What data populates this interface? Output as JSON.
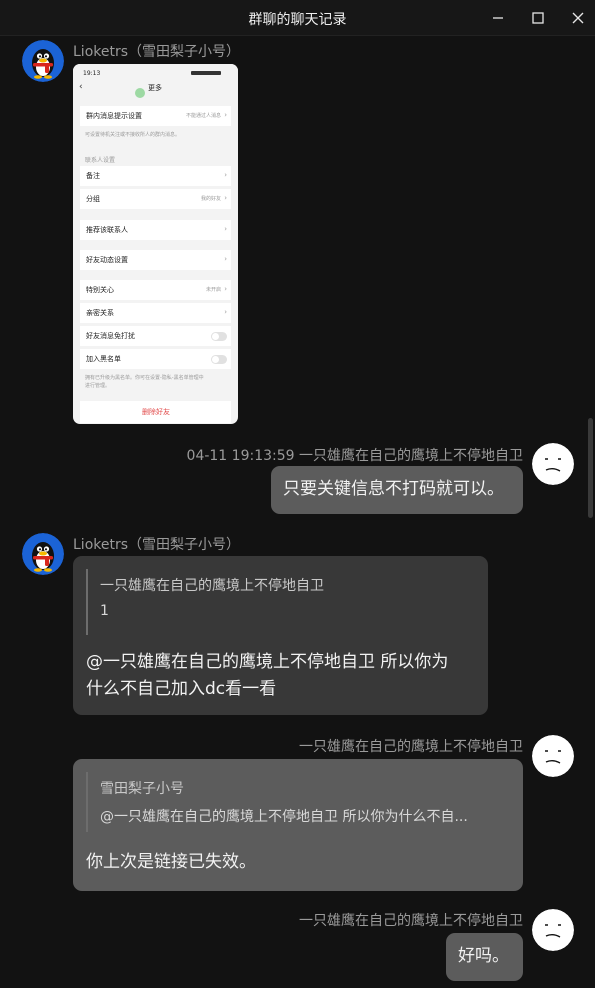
{
  "window": {
    "title": "群聊的聊天记录"
  },
  "messages": [
    {
      "sender": "Lioketrs（雪田梨子小号）",
      "screenshot": {
        "status_time": "19:13",
        "header_title": "更多",
        "rows": [
          {
            "label": "群内消息提示设置",
            "value": "不能通过人消息"
          },
          {
            "label": "备注"
          },
          {
            "label": "分组",
            "value": "我的好友"
          },
          {
            "label": "推荐该联系人"
          },
          {
            "label": "好友动态设置"
          },
          {
            "label": "特别关心",
            "value": "未开启"
          },
          {
            "label": "亲密关系"
          },
          {
            "label": "好友消息免打扰"
          },
          {
            "label": "加入黑名单"
          }
        ],
        "note1": "可设置待机关注或不接收所人的群内消息。",
        "category": "联系人设置",
        "note2a": "拥有已升级为黑名单。你可在设置-隐私-黑名单管理中",
        "note2b": "进行管理。",
        "delete_label": "删除好友"
      }
    },
    {
      "time_sender": "04-11 19:13:59 一只雄鹰在自己的鹰境上不停地自卫",
      "text": "只要关键信息不打码就可以。"
    },
    {
      "sender": "Lioketrs（雪田梨子小号）",
      "quote_name": "一只雄鹰在自己的鹰境上不停地自卫",
      "quote_text": "1",
      "text_line1": "@一只雄鹰在自己的鹰境上不停地自卫 所以你为",
      "text_line2": "什么不自己加入dc看一看"
    },
    {
      "sender": "一只雄鹰在自己的鹰境上不停地自卫",
      "quote_name": "雪田梨子小号",
      "quote_text": "@一只雄鹰在自己的鹰境上不停地自卫 所以你为什么不自...",
      "text": "你上次是链接已失效。"
    },
    {
      "sender": "一只雄鹰在自己的鹰境上不停地自卫",
      "text": "好吗。"
    }
  ]
}
